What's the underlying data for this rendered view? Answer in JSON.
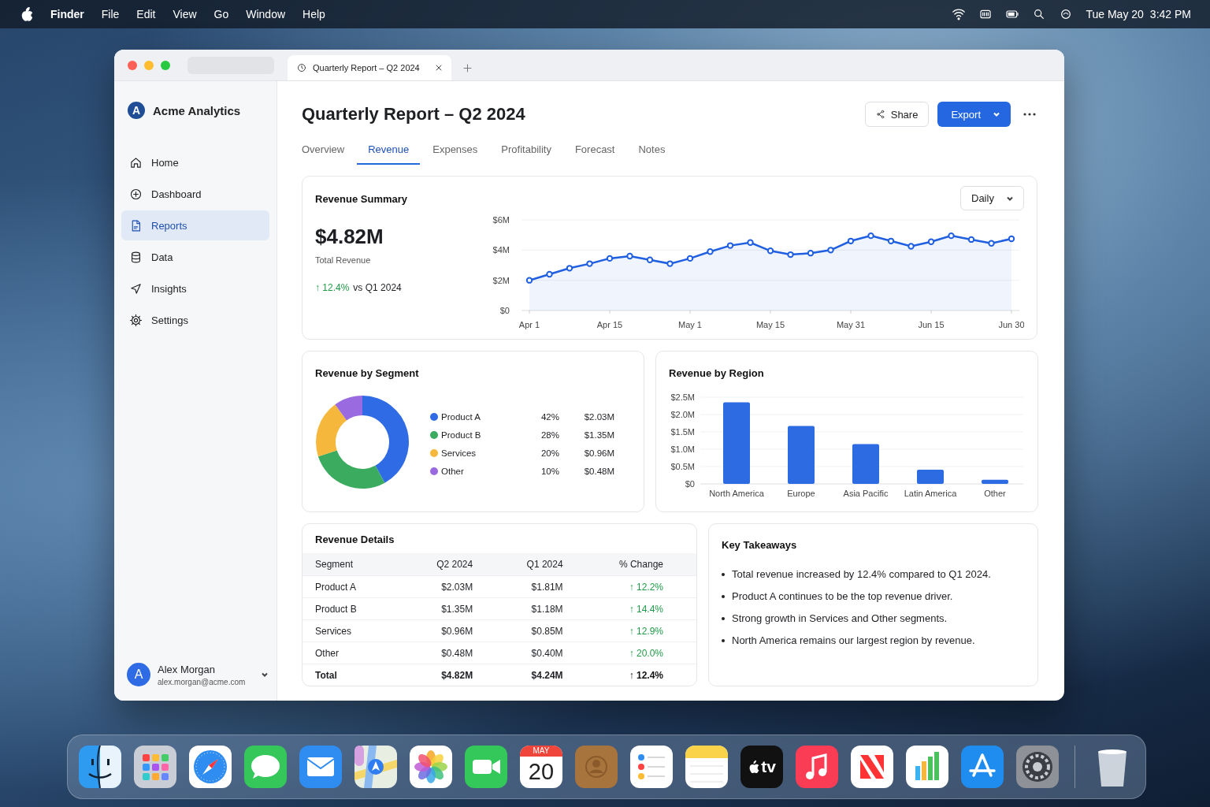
{
  "menu_bar": {
    "app": "Finder",
    "items": [
      "File",
      "Edit",
      "View",
      "Go",
      "Window",
      "Help"
    ],
    "date": "Tue May 20",
    "time": "3:42 PM"
  },
  "browser": {
    "tab_title": "Quarterly Report – Q2 2024"
  },
  "sidebar": {
    "brand": {
      "logo_letter": "A",
      "name": "Acme Analytics"
    },
    "items": [
      {
        "kind": "home",
        "label": "Home",
        "selected": false
      },
      {
        "kind": "dashboard",
        "label": "Dashboard",
        "selected": false
      },
      {
        "kind": "reports",
        "label": "Reports",
        "selected": true
      },
      {
        "kind": "data",
        "label": "Data",
        "selected": false
      },
      {
        "kind": "insights",
        "label": "Insights",
        "selected": false
      },
      {
        "kind": "settings",
        "label": "Settings",
        "selected": false
      }
    ],
    "user": {
      "avatar_letter": "A",
      "name": "Alex Morgan",
      "email": "alex.morgan@acme.com"
    }
  },
  "page": {
    "title": "Quarterly Report – Q2 2024",
    "share_button": "Share",
    "export_button": "Export"
  },
  "tabs": [
    {
      "label": "Overview",
      "selected": false
    },
    {
      "label": "Revenue",
      "selected": true
    },
    {
      "label": "Expenses",
      "selected": false
    },
    {
      "label": "Profitability",
      "selected": false
    },
    {
      "label": "Forecast",
      "selected": false
    },
    {
      "label": "Notes",
      "selected": false
    }
  ],
  "summary": {
    "title": "Revenue Summary",
    "total": "$4.82M",
    "total_label": "Total Revenue",
    "change": "↑ 12.4%",
    "comparison": "vs Q1 2024",
    "period": "Daily",
    "chart_data": {
      "type": "area",
      "grid": true,
      "categories": [
        "Apr 1",
        null,
        null,
        null,
        "Apr 15",
        null,
        null,
        null,
        "May 1",
        null,
        null,
        null,
        "May 15",
        null,
        null,
        null,
        "May 31",
        null,
        null,
        null,
        "Jun 15",
        null,
        null,
        null,
        "Jun 30"
      ],
      "series": [
        {
          "color": "#1f5fe0",
          "values": [
            2.0,
            2.4,
            2.8,
            3.1,
            3.45,
            3.6,
            3.35,
            3.1,
            3.45,
            3.9,
            4.3,
            4.5,
            3.95,
            3.7,
            3.8,
            4.0,
            4.6,
            4.95,
            4.6,
            4.25,
            4.55,
            4.95,
            4.7,
            4.45,
            4.75
          ]
        }
      ],
      "ylim": [
        0,
        6
      ],
      "yticks": [
        {
          "value": 0,
          "label": "$0"
        },
        {
          "value": 2,
          "label": "$2M"
        },
        {
          "value": 4,
          "label": "$4M"
        },
        {
          "value": 6,
          "label": "$6M"
        }
      ]
    }
  },
  "segment": {
    "title": "Revenue by Segment",
    "chart_data": {
      "type": "donut",
      "categories": [
        "Product A",
        "Product B",
        "Services",
        "Other"
      ],
      "values": [
        42,
        28,
        20,
        10
      ]
    },
    "legend": [
      {
        "share": "42%",
        "amount": "$2.03M",
        "color": "#2f6be4"
      },
      {
        "share": "28%",
        "amount": "$1.35M",
        "color": "#3bab5f"
      },
      {
        "share": "20%",
        "amount": "$0.96M",
        "color": "#f6b83c"
      },
      {
        "share": "10%",
        "amount": "$0.48M",
        "color": "#9a6ae0"
      }
    ]
  },
  "region": {
    "title": "Revenue by Region",
    "chart_data": {
      "type": "bar",
      "grid": true,
      "categories": [
        "North America",
        "Europe",
        "Asia Pacific",
        "Latin America",
        "Other"
      ],
      "series": [
        {
          "color": "#2d6be2",
          "values": [
            2.35,
            1.67,
            1.15,
            0.41,
            0.12
          ]
        }
      ],
      "ylim": [
        0,
        2.5
      ],
      "yticks": [
        {
          "value": 0,
          "label": "$0"
        },
        {
          "value": 0.5,
          "label": "$0.5M"
        },
        {
          "value": 1,
          "label": "$1.0M"
        },
        {
          "value": 1.5,
          "label": "$1.5M"
        },
        {
          "value": 2,
          "label": "$2.0M"
        },
        {
          "value": 2.5,
          "label": "$2.5M"
        }
      ]
    }
  },
  "details": {
    "title": "Revenue Details",
    "columns": [
      "Segment",
      "Q2 2024",
      "Q1 2024",
      "% Change"
    ],
    "rows": [
      {
        "total": false,
        "cells": [
          "Product A",
          "$2.03M",
          "$1.81M",
          "↑ 12.2%"
        ]
      },
      {
        "total": false,
        "cells": [
          "Product B",
          "$1.35M",
          "$1.18M",
          "↑ 14.4%"
        ]
      },
      {
        "total": false,
        "cells": [
          "Services",
          "$0.96M",
          "$0.85M",
          "↑ 12.9%"
        ]
      },
      {
        "total": false,
        "cells": [
          "Other",
          "$0.48M",
          "$0.40M",
          "↑ 20.0%"
        ]
      },
      {
        "total": true,
        "cells": [
          "Total",
          "$4.82M",
          "$4.24M",
          "↑ 12.4%"
        ]
      }
    ]
  },
  "takeaways": {
    "title": "Key Takeaways",
    "items": [
      "Total revenue increased by 12.4% compared to Q1 2024.",
      "Product A continues to be the top revenue driver.",
      "Strong growth in Services and Other segments.",
      "North America remains our largest region by revenue."
    ]
  },
  "dock": [
    {
      "kind": "finder"
    },
    {
      "kind": "launchpad"
    },
    {
      "kind": "safari"
    },
    {
      "kind": "messages"
    },
    {
      "kind": "mail"
    },
    {
      "kind": "maps"
    },
    {
      "kind": "photos"
    },
    {
      "kind": "facetime"
    },
    {
      "kind": "calendar",
      "month": "MAY",
      "day": "20"
    },
    {
      "kind": "contacts"
    },
    {
      "kind": "reminders"
    },
    {
      "kind": "notes"
    },
    {
      "kind": "tv",
      "label": "tv"
    },
    {
      "kind": "music"
    },
    {
      "kind": "news"
    },
    {
      "kind": "numbers"
    },
    {
      "kind": "appstore"
    },
    {
      "kind": "settings"
    },
    {
      "kind": "separator"
    },
    {
      "kind": "trash"
    }
  ]
}
